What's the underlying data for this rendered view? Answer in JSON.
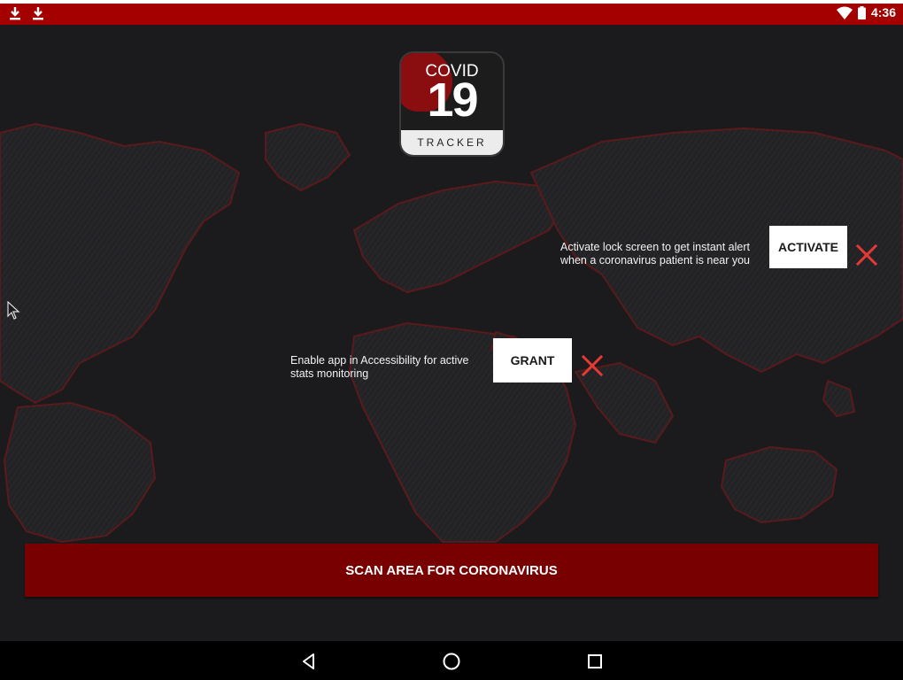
{
  "status_bar": {
    "time": "4:36",
    "left_icons": [
      "download-icon",
      "download-icon"
    ],
    "right_icons": [
      "wifi-icon",
      "battery-icon"
    ],
    "bar_color": "#a40000"
  },
  "logo": {
    "line1": "COVID",
    "line2": "19",
    "line3": "TRACKER"
  },
  "lock_screen_prompt": {
    "text": "Activate lock screen to get instant alert when a coronavirus patient is near you",
    "button_label": "ACTIVATE",
    "dismiss_icon": "close-icon"
  },
  "accessibility_prompt": {
    "text": "Enable app in Accessibility for active stats monitoring",
    "button_label": "GRANT",
    "dismiss_icon": "close-icon"
  },
  "scan_button": {
    "label": "SCAN AREA FOR CORONAVIRUS",
    "color": "#790000"
  },
  "nav_bar": {
    "buttons": [
      "back-icon",
      "home-icon",
      "recents-icon"
    ]
  },
  "colors": {
    "background": "#1b1b1d",
    "accent_red": "#e53935",
    "map_outline": "#5a1a1c"
  }
}
